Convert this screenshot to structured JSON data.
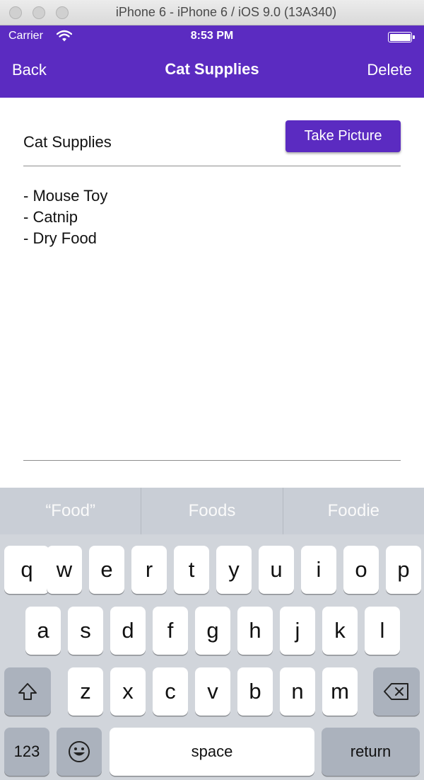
{
  "window": {
    "title": "iPhone 6 - iPhone 6 / iOS 9.0 (13A340)"
  },
  "status_bar": {
    "carrier": "Carrier",
    "time": "8:53 PM"
  },
  "nav": {
    "back": "Back",
    "title": "Cat Supplies",
    "delete": "Delete",
    "color": "#5b2bc1"
  },
  "note": {
    "title": "Cat Supplies",
    "take_picture": "Take Picture",
    "lines": [
      "- Mouse Toy",
      "- Catnip",
      "- Dry Food"
    ]
  },
  "keyboard": {
    "suggestions": [
      "“Food”",
      "Foods",
      "Foodie"
    ],
    "row1": [
      "q",
      "w",
      "e",
      "r",
      "t",
      "y",
      "u",
      "i",
      "o",
      "p"
    ],
    "row2": [
      "a",
      "s",
      "d",
      "f",
      "g",
      "h",
      "j",
      "k",
      "l"
    ],
    "row3": [
      "z",
      "x",
      "c",
      "v",
      "b",
      "n",
      "m"
    ],
    "key_123": "123",
    "key_space": "space",
    "key_return": "return"
  }
}
